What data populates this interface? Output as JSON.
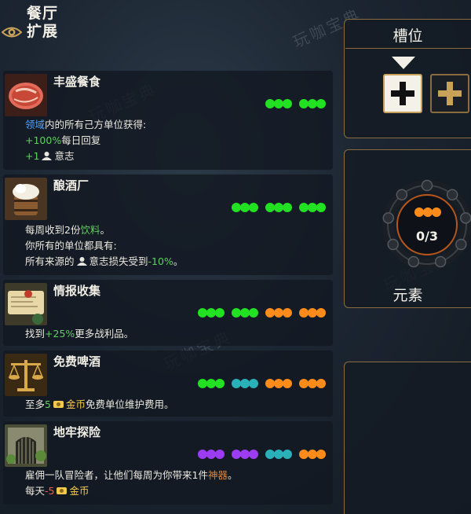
{
  "header": {
    "title_line1": "餐厅",
    "title_line2": "扩展"
  },
  "watermark": {
    "text": "玩咖宝典"
  },
  "colors": {
    "green": "#22e022",
    "teal": "#2ab0b8",
    "orange": "#ff8c1a",
    "purple": "#9b3cf0",
    "gold": "#c9a25a",
    "panel_border": "#8a6c3e"
  },
  "cards": [
    {
      "name": "丰盛餐食",
      "icon": "meat-icon",
      "dots": [
        [
          "green",
          "green",
          "green"
        ],
        [
          "green",
          "green",
          "green"
        ]
      ],
      "line1": {
        "hl": "领域",
        "rest": "内的所有己方单位获得:"
      },
      "line2": {
        "hl": "+100%",
        "rest": "每日回复"
      },
      "line3": {
        "hl": "+1",
        "rest": "意志"
      }
    },
    {
      "name": "酿酒厂",
      "icon": "beer-barrel-icon",
      "dots": [
        [
          "green",
          "green",
          "green"
        ],
        [
          "green",
          "green",
          "green"
        ],
        [
          "green",
          "green",
          "green"
        ]
      ],
      "line1": {
        "pre": "每周收到2份",
        "hl": "饮料",
        "post": "。"
      },
      "line2": {
        "text": "你所有的单位都具有:"
      },
      "line3": {
        "pre": "所有来源的",
        "mid": "意志损失受到",
        "hl": "-10%",
        "post": "。"
      }
    },
    {
      "name": "情报收集",
      "icon": "scroll-map-icon",
      "dots": [
        [
          "green",
          "green",
          "green"
        ],
        [
          "green",
          "green",
          "green"
        ],
        [
          "orange",
          "orange",
          "orange"
        ],
        [
          "orange",
          "orange",
          "orange"
        ]
      ],
      "line1": {
        "pre": "找到",
        "hl": "+25%",
        "post": "更多战利品。"
      }
    },
    {
      "name": "免费啤酒",
      "icon": "scales-icon",
      "dots": [
        [
          "green",
          "green",
          "green"
        ],
        [
          "teal",
          "teal",
          "teal"
        ],
        [
          "orange",
          "orange",
          "orange"
        ],
        [
          "orange",
          "orange",
          "orange"
        ]
      ],
      "line1": {
        "pre": "至多",
        "hl": "5",
        "gold": "金币",
        "post": "免费单位维护费用。"
      }
    },
    {
      "name": "地牢探险",
      "icon": "dungeon-gate-icon",
      "dots": [
        [
          "purple",
          "purple",
          "purple"
        ],
        [
          "purple",
          "purple",
          "purple"
        ],
        [
          "teal",
          "teal",
          "teal"
        ],
        [
          "orange",
          "orange",
          "orange"
        ]
      ],
      "line1": {
        "pre": "雇佣一队冒险者，让他们每周为你带来1件",
        "hl": "神器",
        "post": "。"
      },
      "line2": {
        "pre": "每天",
        "hl": "-5",
        "gold": "金币"
      }
    }
  ],
  "slots_panel": {
    "title": "槽位"
  },
  "elements_panel": {
    "title": "元素",
    "count": "0/3",
    "dots": [
      "orange",
      "orange",
      "orange"
    ]
  }
}
